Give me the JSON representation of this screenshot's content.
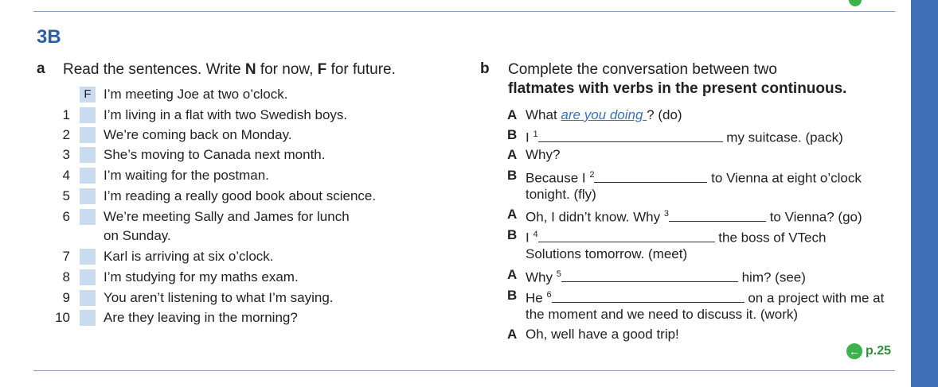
{
  "unit": "3B",
  "section_a": {
    "letter": "a",
    "instruction_pre": "Read the sentences. Write ",
    "instruction_n": "N",
    "instruction_mid": " for now, ",
    "instruction_f": "F",
    "instruction_post": " for future.",
    "example": {
      "answer": "F",
      "text": "I’m meeting Joe at two o’clock."
    },
    "items": [
      {
        "num": "1",
        "text": "I’m living in a flat with two Swedish boys."
      },
      {
        "num": "2",
        "text": "We’re coming back on Monday."
      },
      {
        "num": "3",
        "text": "She’s moving to Canada next month."
      },
      {
        "num": "4",
        "text": "I’m waiting for the postman."
      },
      {
        "num": "5",
        "text": "I’m reading a really good book about science."
      },
      {
        "num": "6",
        "text": "We’re meeting Sally and James for lunch",
        "cont": "on Sunday."
      },
      {
        "num": "7",
        "text": "Karl is arriving at six o’clock."
      },
      {
        "num": "8",
        "text": "I’m studying for my maths exam."
      },
      {
        "num": "9",
        "text": "You aren’t listening to what I’m saying."
      },
      {
        "num": "10",
        "text": "Are they leaving in the morning?"
      }
    ]
  },
  "section_b": {
    "letter": "b",
    "instruction_1": "Complete the conversation between two",
    "instruction_2": "flatmates with verbs in the present continuous.",
    "lines": {
      "l0": {
        "speaker": "A",
        "pre": "What ",
        "answer": "are you doing ",
        "post": "? (do)"
      },
      "l1": {
        "speaker": "B",
        "pre": "I ",
        "sup": "1",
        "post": " my suitcase. (pack)"
      },
      "l2": {
        "speaker": "A",
        "pre": "Why?"
      },
      "l3": {
        "speaker": "B",
        "pre": "Because I ",
        "sup": "2",
        "post": " to Vienna at eight o’clock",
        "cont": "tonight. (fly)"
      },
      "l4": {
        "speaker": "A",
        "pre": "Oh, I didn’t know. Why ",
        "sup": "3",
        "post": " to Vienna? (go)"
      },
      "l5": {
        "speaker": "B",
        "pre": "I ",
        "sup": "4",
        "post": " the boss of VTech",
        "cont": "Solutions tomorrow. (meet)"
      },
      "l6": {
        "speaker": "A",
        "pre": "Why ",
        "sup": "5",
        "post": " him? (see)"
      },
      "l7": {
        "speaker": "B",
        "pre": "He ",
        "sup": "6",
        "post": " on a project with me at",
        "cont": "the moment and we need to discuss it. (work)"
      },
      "l8": {
        "speaker": "A",
        "pre": "Oh, well have a good trip!"
      }
    }
  },
  "page_ref": "p.25",
  "colors": {
    "unit_blue": "#2e5fa6",
    "box_blue": "#c8dbef",
    "answer_blue": "#3f6fb5",
    "ref_green": "#3bb34a"
  }
}
